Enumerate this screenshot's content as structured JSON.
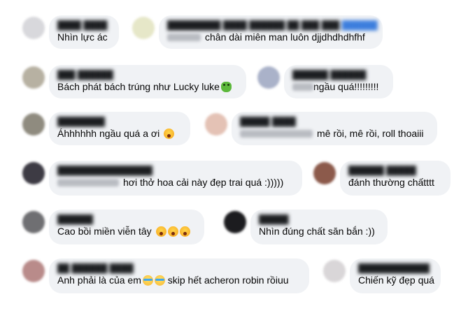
{
  "colors": {
    "bubble_bg": "#f0f2f5",
    "text": "#050505"
  },
  "comments": [
    {
      "id": "c1",
      "text": "Nhìn lực ác"
    },
    {
      "id": "c2",
      "text": "chân dài miên man luôn djjdhdhdhfhf"
    },
    {
      "id": "c3",
      "text": "Bách phát bách trúng như Lucky luke",
      "emoji": [
        "frog-emoji"
      ]
    },
    {
      "id": "c4",
      "text": "ngầu quá!!!!!!!!!"
    },
    {
      "id": "c5",
      "text": "Áhhhhhh ngầu quá a ơi",
      "emoji": [
        "wow-emoji"
      ]
    },
    {
      "id": "c6",
      "text": "mê rồi, mê rồi, roll thoaiii"
    },
    {
      "id": "c7",
      "text": "hơi thở hoa cải này đẹp trai quá :)))))"
    },
    {
      "id": "c8",
      "text": "đánh thường chấtttt"
    },
    {
      "id": "c9",
      "text": "Cao bồi miền viễn tây",
      "emoji": [
        "wow-emoji",
        "wow-emoji",
        "wow-emoji"
      ]
    },
    {
      "id": "c10",
      "text": "Nhìn đúng chất săn bắn :))"
    },
    {
      "id": "c11",
      "text": "Anh phải là của em",
      "emoji_inline": [
        "cry-emoji",
        "cry-emoji"
      ],
      "text_after": " skip hết acheron robin rồiuu"
    },
    {
      "id": "c12",
      "text": "Chiến kỹ đẹp quá"
    }
  ]
}
